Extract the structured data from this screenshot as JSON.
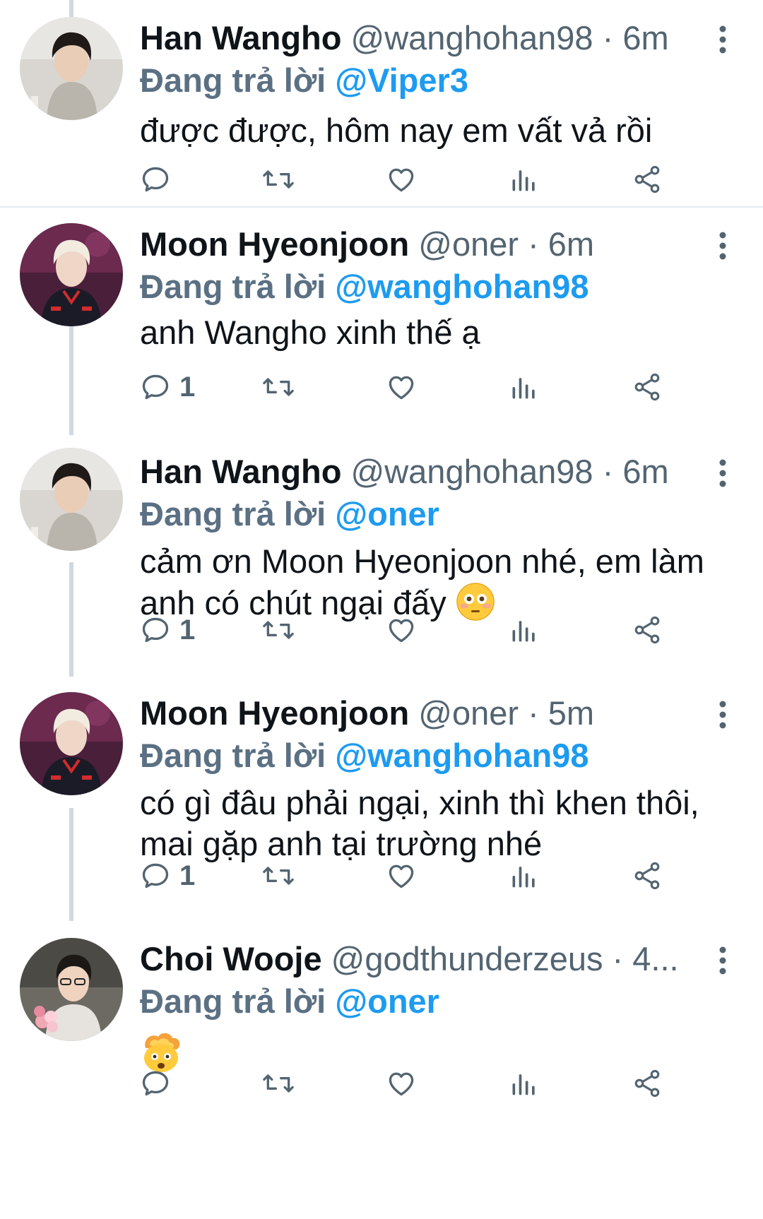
{
  "colors": {
    "accent": "#1d9bf0",
    "secondary_text": "#536471",
    "replying_text": "#5b7083",
    "divider": "#e6ecf0",
    "thread_line": "#cfd9de"
  },
  "replying_prefix": "Đang trả lời",
  "tweets": [
    {
      "name": "Han Wangho",
      "handle": "@wanghohan98",
      "time": "6m",
      "reply_to": "@Viper3",
      "text": "được được, hôm nay em vất vả rồi",
      "reply_count": "",
      "avatar": "han-wangho-avatar"
    },
    {
      "name": "Moon Hyeonjoon",
      "handle": "@oner",
      "time": "6m",
      "reply_to": "@wanghohan98",
      "text": "anh Wangho xinh thế ạ",
      "reply_count": "1",
      "avatar": "moon-hyeonjoon-avatar"
    },
    {
      "name": "Han Wangho",
      "handle": "@wanghohan98",
      "time": "6m",
      "reply_to": "@oner",
      "text": "cảm ơn Moon Hyeonjoon nhé, em làm anh có chút ngại đấy",
      "emoji": "flushed-face",
      "reply_count": "1",
      "avatar": "han-wangho-avatar"
    },
    {
      "name": "Moon Hyeonjoon",
      "handle": "@oner",
      "time": "5m",
      "reply_to": "@wanghohan98",
      "text": "có gì đâu phải ngại, xinh thì khen thôi, mai gặp anh tại trường nhé",
      "reply_count": "1",
      "avatar": "moon-hyeonjoon-avatar"
    },
    {
      "name": "Choi Wooje",
      "handle": "@godthunderzeus",
      "time": "4...",
      "reply_to": "@oner",
      "text": "",
      "emoji": "exploding-head",
      "reply_count": "",
      "avatar": "choi-wooje-avatar"
    }
  ]
}
